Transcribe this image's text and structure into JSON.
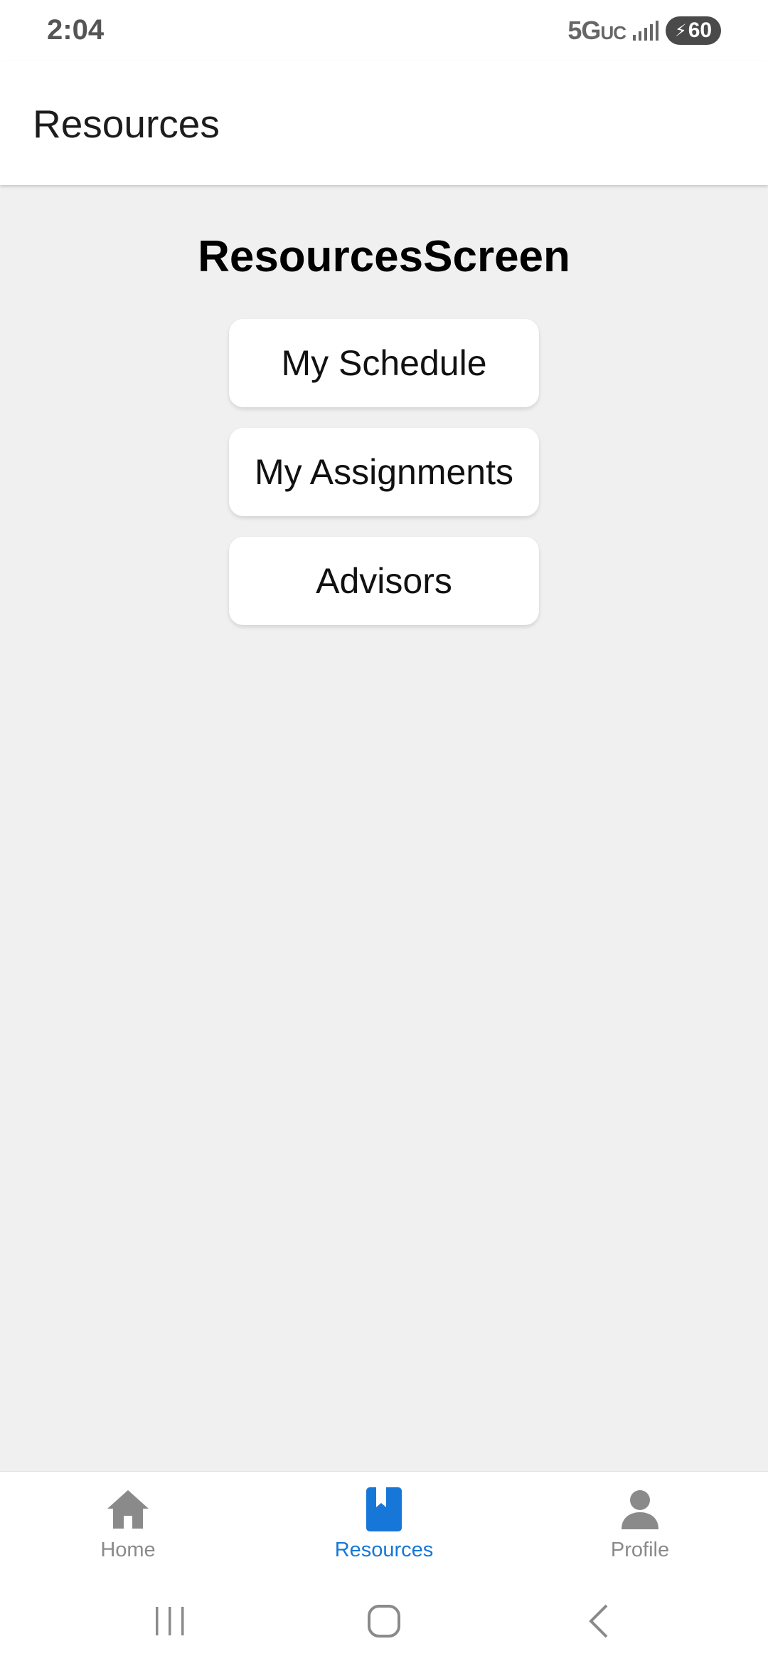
{
  "status_bar": {
    "time": "2:04",
    "network": "5G",
    "network_suffix": "UC",
    "battery": "60"
  },
  "header": {
    "title": "Resources"
  },
  "main": {
    "screen_title": "ResourcesScreen",
    "buttons": [
      {
        "label": "My Schedule"
      },
      {
        "label": "My Assignments"
      },
      {
        "label": "Advisors"
      }
    ]
  },
  "tabs": [
    {
      "label": "Home",
      "icon": "home-icon",
      "active": false
    },
    {
      "label": "Resources",
      "icon": "bookmark-book-icon",
      "active": true
    },
    {
      "label": "Profile",
      "icon": "person-icon",
      "active": false
    }
  ],
  "colors": {
    "accent": "#1677d8",
    "inactive": "#8a8a8a",
    "background": "#f0f0f0"
  },
  "system_nav": [
    "recents-icon",
    "home-circle-icon",
    "back-icon"
  ]
}
